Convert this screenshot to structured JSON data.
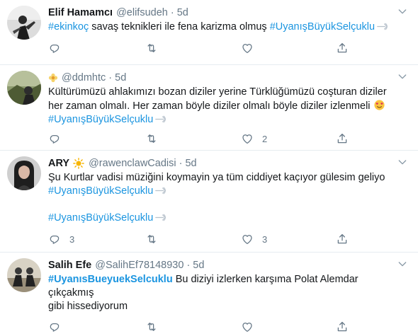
{
  "tweets": [
    {
      "name": "Elif Hamamcı",
      "handle": "@elifsudeh",
      "dot": "·",
      "time": "5d",
      "line1_tag": "#ekinkoç",
      "line1_text": " savaş teknikleri ile fena karizma olmuş ",
      "line1_tag2": "#UyanışBüyükSelçuklu",
      "replies": "",
      "retweets": "",
      "likes": ""
    },
    {
      "name": "",
      "handle": "@ddmhtc",
      "dot": "·",
      "time": "5d",
      "line1": "Kültürümüzü ahlakımızı bozan diziler yerine Türklüğümüzü coşturan diziler",
      "line2": "her zaman olmalı. Her zaman böyle diziler olmalı böyle diziler izlenmeli",
      "line3_tag": "#UyanışBüyükSelçuklu",
      "replies": "",
      "retweets": "",
      "likes": "2"
    },
    {
      "name": "ARY",
      "handle": "@rawenclawCadisi",
      "dot": "·",
      "time": "5d",
      "line1": "Şu Kurtlar vadisi müziğini koymayin ya tüm ciddiyet kaçıyor gülesim geliyo",
      "line2_tag": "#UyanışBüyükSelçuklu",
      "line3_tag": "#UyanışBüyükSelçuklu",
      "replies": "3",
      "retweets": "",
      "likes": "3"
    },
    {
      "name": "Salih Efe",
      "handle": "@SalihEf78148930",
      "dot": "·",
      "time": "5d",
      "line1_tag": "#UyanısBueyuekSelcuklu",
      "line1_text": " Bu diziyi izlerken karşıma Polat Alemdar çıkçakmış",
      "line2": "gibi hissediyorum",
      "replies": "",
      "retweets": "",
      "likes": ""
    }
  ],
  "colors": {
    "hashtag": "#1b95e0",
    "muted": "#657786",
    "border": "#e6ecf0"
  },
  "icons": [
    "caret-down-icon",
    "reply-icon",
    "retweet-icon",
    "like-icon",
    "share-icon",
    "hashtag-emoji-icon",
    "flower-emoji-icon",
    "sun-emoji-icon",
    "heart-face-emoji-icon"
  ]
}
